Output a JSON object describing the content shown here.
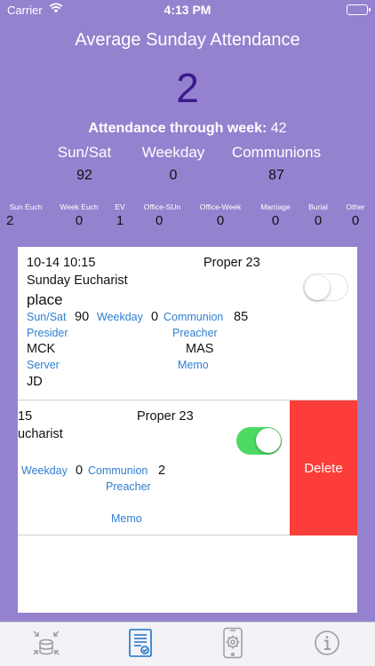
{
  "status_bar": {
    "carrier": "Carrier",
    "time": "4:13 PM"
  },
  "header": {
    "title": "Average Sunday Attendance",
    "average": "2",
    "week_label": "Attendance through week:",
    "week_value": "42"
  },
  "summary": {
    "labels": [
      "Sun/Sat",
      "Weekday",
      "Communions"
    ],
    "values": [
      "92",
      "0",
      "87"
    ]
  },
  "categories": [
    {
      "label": "Sun Euch",
      "value": "2"
    },
    {
      "label": "Week Euch",
      "value": "0"
    },
    {
      "label": "EV",
      "value": "1"
    },
    {
      "label": "Office-SUn",
      "value": "0"
    },
    {
      "label": "Office-Week",
      "value": "0"
    },
    {
      "label": "Marriage",
      "value": "0"
    },
    {
      "label": "Burial",
      "value": "0"
    },
    {
      "label": "Other",
      "value": "0"
    }
  ],
  "services": [
    {
      "datetime": "10-14 10:15",
      "proper": "Proper 23",
      "service_type": "Sunday Eucharist",
      "place": "place",
      "sunsat_label": "Sun/Sat",
      "sunsat_value": "90",
      "weekday_label": "Weekday",
      "weekday_value": "0",
      "communion_label": "Communion",
      "communion_value": "85",
      "presider_label": "Presider",
      "presider_value": "MCK",
      "preacher_label": "Preacher",
      "preacher_value": "MAS",
      "server_label": "Server",
      "server_value": "JD",
      "memo_label": "Memo",
      "toggle_on": false
    },
    {
      "datetime": "15",
      "proper": "Proper 23",
      "service_type": "ucharist",
      "weekday_label": "Weekday",
      "weekday_value": "0",
      "communion_label": "Communion",
      "communion_value": "2",
      "preacher_label": "Preacher",
      "memo_label": "Memo",
      "toggle_on": true,
      "delete_label": "Delete"
    }
  ],
  "tabbar": {
    "tabs": [
      {
        "icon": "database-sync-icon",
        "active": false
      },
      {
        "icon": "checklist-document-icon",
        "active": true
      },
      {
        "icon": "phone-settings-icon",
        "active": false
      },
      {
        "icon": "info-icon",
        "active": false
      }
    ]
  },
  "colors": {
    "background": "#9482cf",
    "accent_text": "#3b1a8c",
    "link_blue": "#2f7ecf",
    "toggle_green": "#4cd964",
    "delete_red": "#fc3d39",
    "tab_active": "#1a73c9",
    "tab_inactive": "#9b9ba1"
  }
}
